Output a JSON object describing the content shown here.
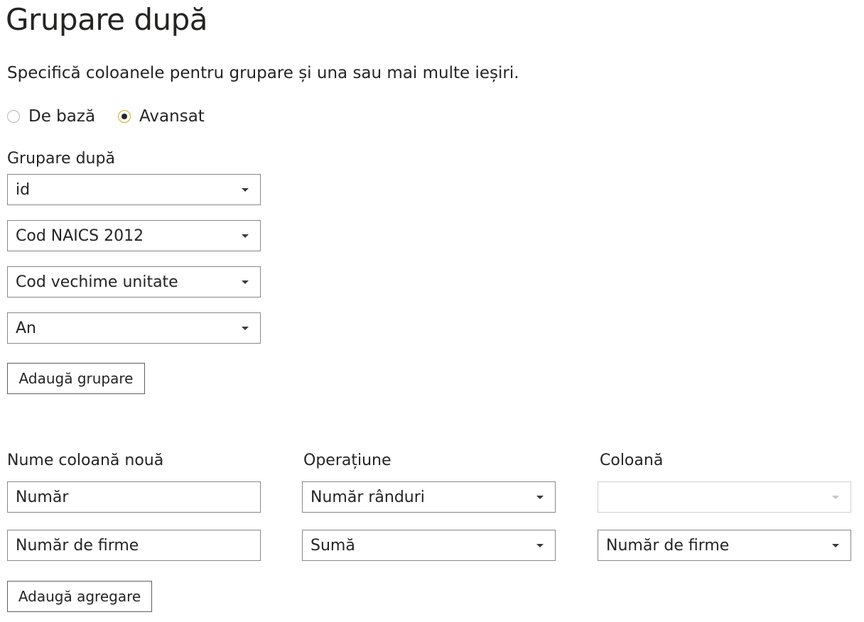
{
  "dialog": {
    "title": "Grupare după",
    "subtitle": "Specifică coloanele pentru grupare și una sau mai multe ieșiri."
  },
  "mode": {
    "options": [
      {
        "label": "De bază",
        "selected": false
      },
      {
        "label": "Avansat",
        "selected": true
      }
    ]
  },
  "group_by": {
    "label": "Grupare după",
    "fields": [
      "id",
      "Cod NAICS 2012",
      "Cod vechime unitate",
      "An"
    ],
    "add_button": "Adaugă grupare"
  },
  "aggregations": {
    "headers": {
      "new_column": "Nume coloană nouă",
      "operation": "Operațiune",
      "column": "Coloană"
    },
    "rows": [
      {
        "name": "Număr",
        "operation": "Număr rânduri",
        "column": ""
      },
      {
        "name": "Număr de firme",
        "operation": "Sumă",
        "column": "Număr de firme"
      }
    ],
    "add_button": "Adaugă agregare"
  },
  "colors": {
    "text": "#252423",
    "border": "#8a8886",
    "radio_selected_ring": "#d1a91a",
    "disabled_border": "#d2d0ce"
  }
}
